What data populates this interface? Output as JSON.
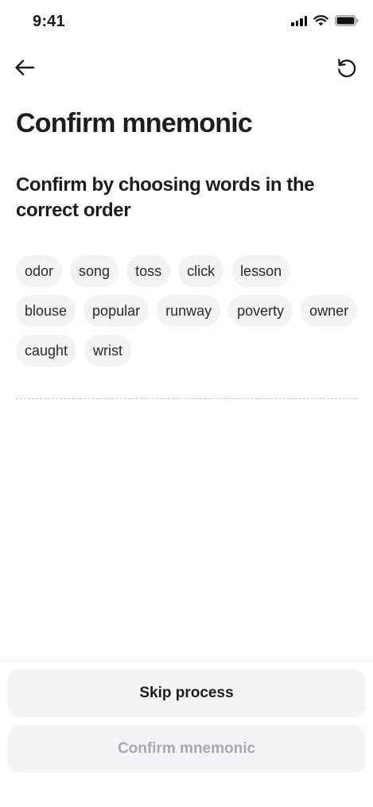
{
  "status_bar": {
    "time": "9:41"
  },
  "header": {
    "back_icon": "arrow-left-icon",
    "reset_icon": "rotate-ccw-icon"
  },
  "title": "Confirm mnemonic",
  "instruction": "Confirm by choosing words in the correct order",
  "words": [
    "odor",
    "song",
    "toss",
    "click",
    "lesson",
    "blouse",
    "popular",
    "runway",
    "poverty",
    "owner",
    "caught",
    "wrist"
  ],
  "buttons": {
    "skip": "Skip process",
    "confirm": "Confirm mnemonic"
  },
  "colors": {
    "chip_bg": "#f2f3f5",
    "button_bg": "#f3f4f6",
    "disabled_text": "#a8a9ad"
  }
}
